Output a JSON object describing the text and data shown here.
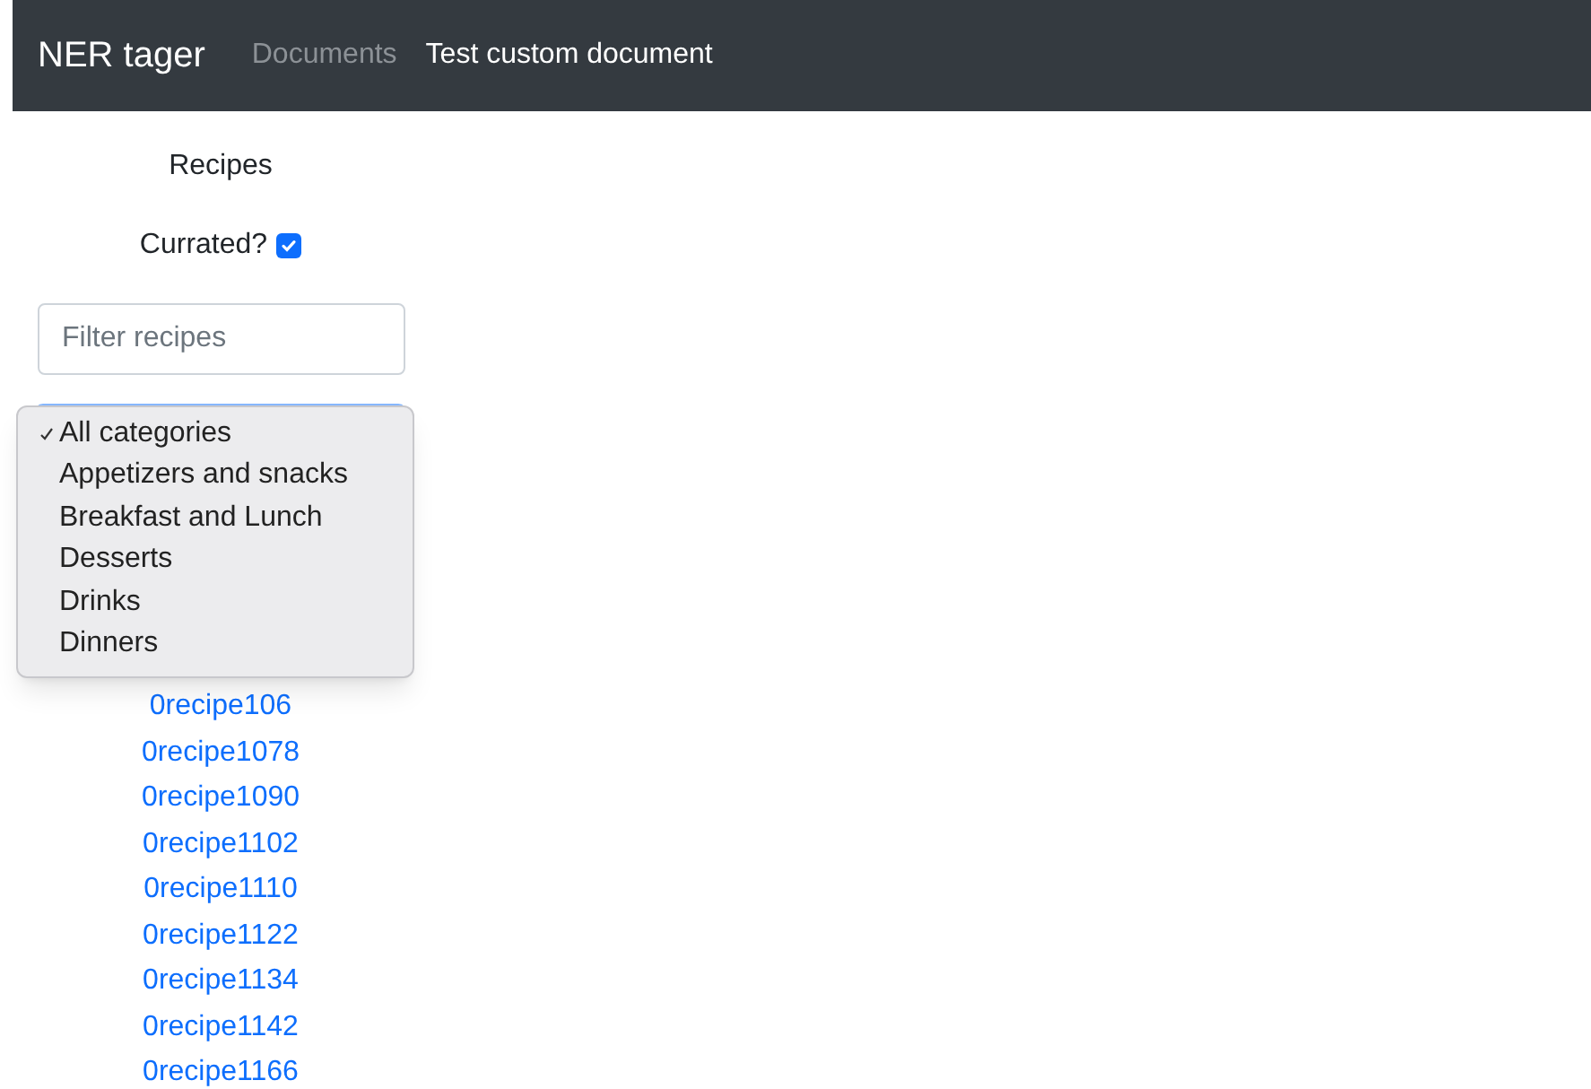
{
  "navbar": {
    "brand": "NER tager",
    "links": [
      {
        "label": "Documents",
        "selected": false
      },
      {
        "label": "Test custom document",
        "selected": true
      }
    ]
  },
  "sidebar": {
    "title": "Recipes",
    "curated": {
      "label": "Currated?",
      "checked": true
    },
    "filter": {
      "placeholder": "Filter recipes"
    },
    "category_menu": [
      {
        "label": "All categories",
        "selected": true
      },
      {
        "label": "Appetizers and snacks",
        "selected": false
      },
      {
        "label": "Breakfast and Lunch",
        "selected": false
      },
      {
        "label": "Desserts",
        "selected": false
      },
      {
        "label": "Drinks",
        "selected": false
      },
      {
        "label": "Dinners",
        "selected": false
      }
    ],
    "recipes": [
      "0recipe106",
      "0recipe1078",
      "0recipe1090",
      "0recipe1102",
      "0recipe1110",
      "0recipe1122",
      "0recipe1134",
      "0recipe1142",
      "0recipe1166"
    ]
  }
}
